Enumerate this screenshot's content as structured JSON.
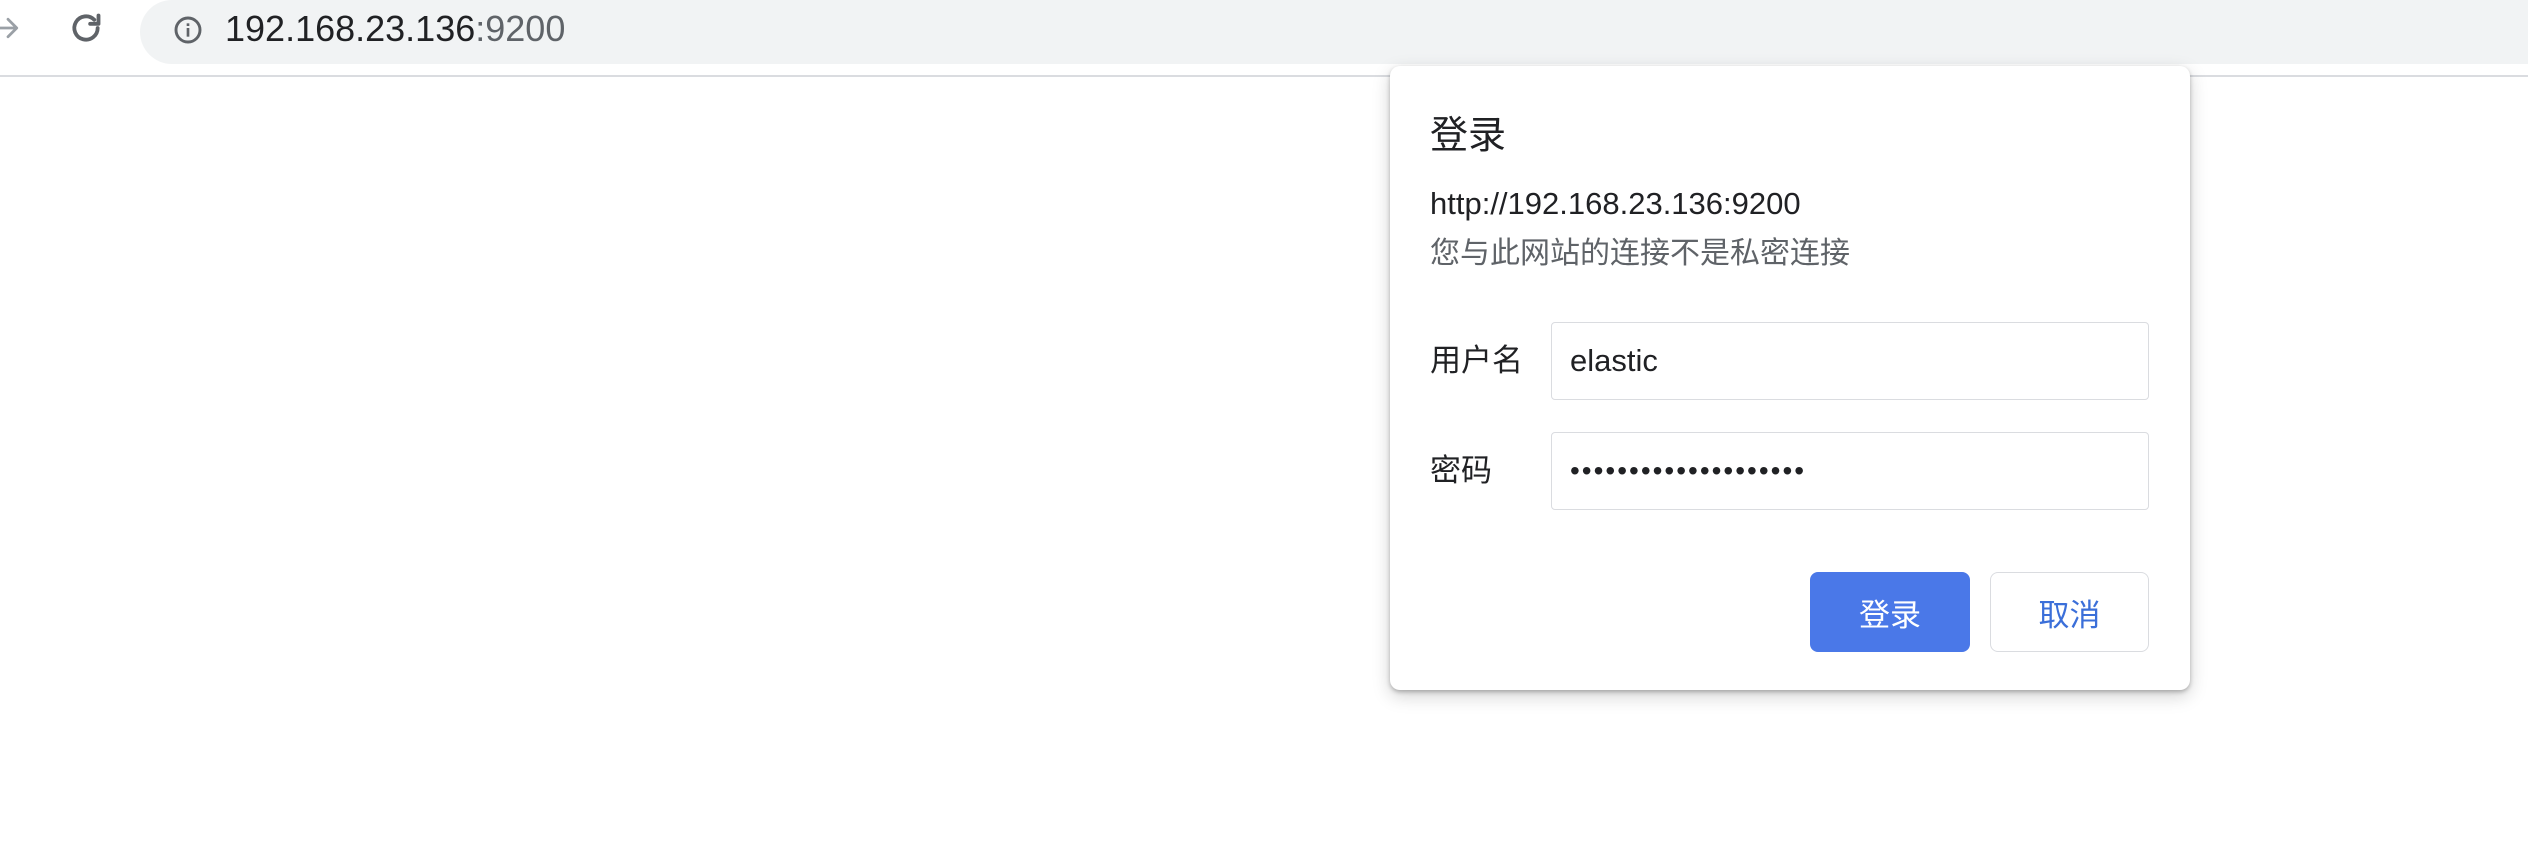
{
  "browser": {
    "url_host": "192.168.23.136",
    "url_port": ":9200",
    "icons": {
      "forward": "forward-arrow-icon",
      "reload": "reload-icon",
      "site_info": "info-icon"
    }
  },
  "dialog": {
    "title": "登录",
    "url": "http://192.168.23.136:9200",
    "warning": "您与此网站的连接不是私密连接",
    "username": {
      "label": "用户名",
      "value": "elastic"
    },
    "password": {
      "label": "密码",
      "value": "••••••••••••••••••••"
    },
    "login_label": "登录",
    "cancel_label": "取消",
    "colors": {
      "primary": "#4a78e8",
      "cancel_text": "#3b6fd9"
    }
  }
}
